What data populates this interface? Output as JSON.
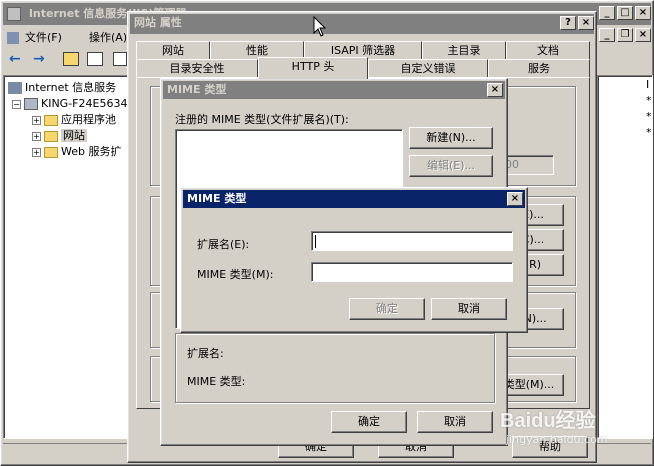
{
  "mmc": {
    "title": "Internet 信息服务(IIS)管理器",
    "menu": [
      "文件(F)",
      "操作(A)"
    ],
    "tree": {
      "root": "Internet 信息服务",
      "computer": "KING-F24E5634",
      "items": [
        "应用程序池",
        "网站",
        "Web 服务扩"
      ]
    },
    "right_column_header": "I",
    "right_column_values": [
      "*",
      "*",
      "*"
    ]
  },
  "props": {
    "title": "网站 属性",
    "help_btn": "?",
    "close_btn": "×",
    "tabs_row1": [
      "网站",
      "性能",
      "ISAPI 筛选器",
      "主目录",
      "文档"
    ],
    "tabs_row2": [
      "目录安全性",
      "HTTP 头",
      "自定义错误",
      "服务"
    ],
    "right_buttons": [
      "E)...",
      "C)...",
      "(R)",
      "(N)...",
      "类型(M)..."
    ],
    "spinner_value": "00",
    "bottom_buttons": [
      "确定",
      "取消",
      "帮助"
    ]
  },
  "mime_list": {
    "title": "MIME 类型",
    "close_btn": "×",
    "list_label": "注册的 MIME 类型(文件扩展名)(T):",
    "new_btn": "新建(N)...",
    "edit_btn": "编辑(E)...",
    "detail_ext_label": "扩展名:",
    "detail_mime_label": "MIME 类型:",
    "ok_btn": "确定",
    "cancel_btn": "取消"
  },
  "mime_dialog": {
    "title": "MIME 类型",
    "close_btn": "×",
    "ext_label": "扩展名(E):",
    "ext_value": "",
    "mime_label": "MIME 类型(M):",
    "mime_value": "",
    "ok_btn": "确定",
    "cancel_btn": "取消"
  },
  "watermark": {
    "brand": "Baidu经验",
    "url": "jingyan.baidu.com"
  },
  "colors": {
    "active_title": "#0a246a",
    "inactive_title": "#808080",
    "face": "#d4d0c8"
  }
}
